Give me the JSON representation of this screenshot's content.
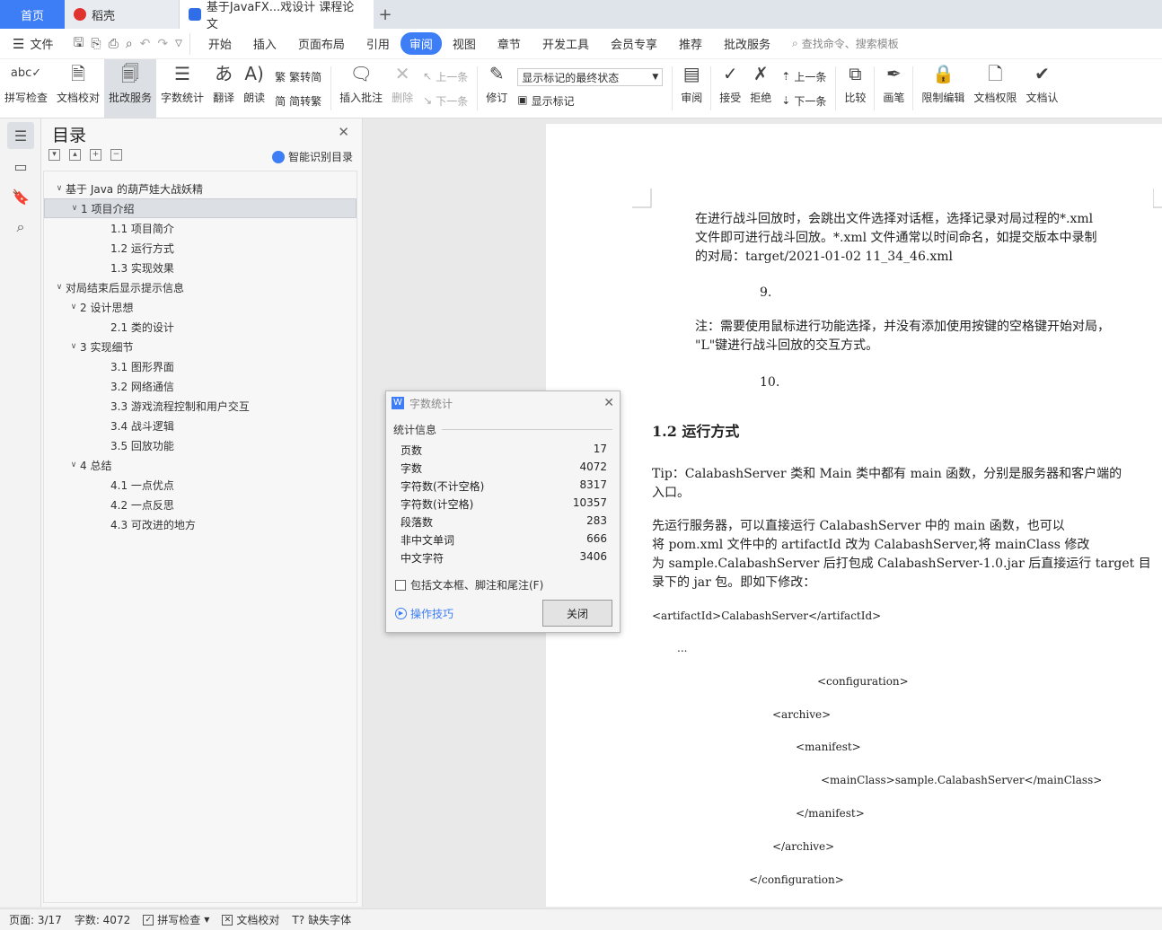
{
  "titlebar": {
    "home_tab": "首页",
    "daoke_tab": "稻壳",
    "doc_tab": "基于JavaFX...戏设计 课程论文"
  },
  "menubar": {
    "file": "文件",
    "items": [
      "开始",
      "插入",
      "页面布局",
      "引用",
      "审阅",
      "视图",
      "章节",
      "开发工具",
      "会员专享",
      "推荐",
      "批改服务"
    ],
    "active": "审阅",
    "search_placeholder": "查找命令、搜索模板"
  },
  "ribbon": {
    "spell": "拼写检查",
    "proofread": "文档校对",
    "correction": "批改服务",
    "wordcount": "字数统计",
    "translate": "翻译",
    "read": "朗读",
    "trad_to_simp": "繁转简",
    "simp_to_trad": "简转繁",
    "insert_comment": "插入批注",
    "delete": "删除",
    "prev_comment": "上一条",
    "next_comment": "下一条",
    "revise": "修订",
    "mark_select": "显示标记的最终状态",
    "show_marks": "显示标记",
    "review": "审阅",
    "accept": "接受",
    "reject": "拒绝",
    "prev_change": "上一条",
    "next_change": "下一条",
    "compare": "比较",
    "pen": "画笔",
    "restrict": "限制编辑",
    "doc_rights": "文档权限",
    "doc_auth": "文档认"
  },
  "toc": {
    "title": "目录",
    "smart": "智能识别目录",
    "items": [
      {
        "text": "基于 Java 的葫芦娃大战妖精",
        "level": 0,
        "arrow": "v"
      },
      {
        "text": "1 项目介绍",
        "level": 1,
        "arrow": "v"
      },
      {
        "text": "1.1 项目简介",
        "level": 2,
        "arrow": ""
      },
      {
        "text": "1.2 运行方式",
        "level": 2,
        "arrow": ""
      },
      {
        "text": "1.3 实现效果",
        "level": 2,
        "arrow": ""
      },
      {
        "text": "对局结束后显示提示信息",
        "level": 0,
        "arrow": "v"
      },
      {
        "text": "2 设计思想",
        "level": 1,
        "arrow": "v"
      },
      {
        "text": "2.1 类的设计",
        "level": 2,
        "arrow": ""
      },
      {
        "text": "3 实现细节",
        "level": 1,
        "arrow": "v"
      },
      {
        "text": "3.1 图形界面",
        "level": 2,
        "arrow": ""
      },
      {
        "text": "3.2 网络通信",
        "level": 2,
        "arrow": ""
      },
      {
        "text": "3.3 游戏流程控制和用户交互",
        "level": 2,
        "arrow": ""
      },
      {
        "text": "3.4 战斗逻辑",
        "level": 2,
        "arrow": ""
      },
      {
        "text": "3.5 回放功能",
        "level": 2,
        "arrow": ""
      },
      {
        "text": "4 总结",
        "level": 1,
        "arrow": "v"
      },
      {
        "text": "4.1 一点优点",
        "level": 2,
        "arrow": ""
      },
      {
        "text": "4.2 一点反思",
        "level": 2,
        "arrow": ""
      },
      {
        "text": "4.3 可改进的地方",
        "level": 2,
        "arrow": ""
      }
    ],
    "selected_index": 1
  },
  "document": {
    "p1_a": "在进行战斗回放时，会跳出文件选择对话框，选择记录对局过程的*.xml",
    "p1_b": "文件即可进行战斗回放。*.xml 文件通常以时间命名，如提交版本中录制",
    "p1_c": "的对局：target/2021-01-02 11_34_46.xml",
    "n9": "9.",
    "p2_a": "注：需要使用鼠标进行功能选择，并没有添加使用按键的空格键开始对局，",
    "p2_b": "\"L\"键进行战斗回放的交互方式。",
    "n10": "10.",
    "heading": "1.2  运行方式",
    "p3_a": "Tip：CalabashServer 类和 Main 类中都有  main  函数，分别是服务器和客户端的",
    "p3_b": "入口。",
    "p4_a": "先运行服务器，可以直接运行 CalabashServer 中的  main  函数，也可以",
    "p4_b": "将 pom.xml 文件中的 artifactId 改为 CalabashServer,将 mainClass 修改",
    "p4_c": "为 sample.CalabashServer 后打包成 CalabashServer-1.0.jar 后直接运行  target  目",
    "p4_d": "录下的  jar  包。即如下修改：",
    "code1": "<artifactId>CalabashServer</artifactId>",
    "code2": "...",
    "code3": "<configuration>",
    "code4": "<archive>",
    "code5": "<manifest>",
    "code6": "<mainClass>sample.CalabashServer</mainClass>",
    "code7": "</manifest>",
    "code8": "</archive>",
    "code9": "</configuration>"
  },
  "dialog": {
    "title": "字数统计",
    "section": "统计信息",
    "rows": [
      {
        "label": "页数",
        "value": "17"
      },
      {
        "label": "字数",
        "value": "4072"
      },
      {
        "label": "字符数(不计空格)",
        "value": "8317"
      },
      {
        "label": "字符数(计空格)",
        "value": "10357"
      },
      {
        "label": "段落数",
        "value": "283"
      },
      {
        "label": "非中文单词",
        "value": "666"
      },
      {
        "label": "中文字符",
        "value": "3406"
      }
    ],
    "checkbox": "包括文本框、脚注和尾注(F)",
    "tips": "操作技巧",
    "close_btn": "关闭"
  },
  "status": {
    "page": "页面: 3/17",
    "words": "字数: 4072",
    "spell": "拼写检查",
    "proof": "文档校对",
    "missing_font": "缺失字体"
  }
}
